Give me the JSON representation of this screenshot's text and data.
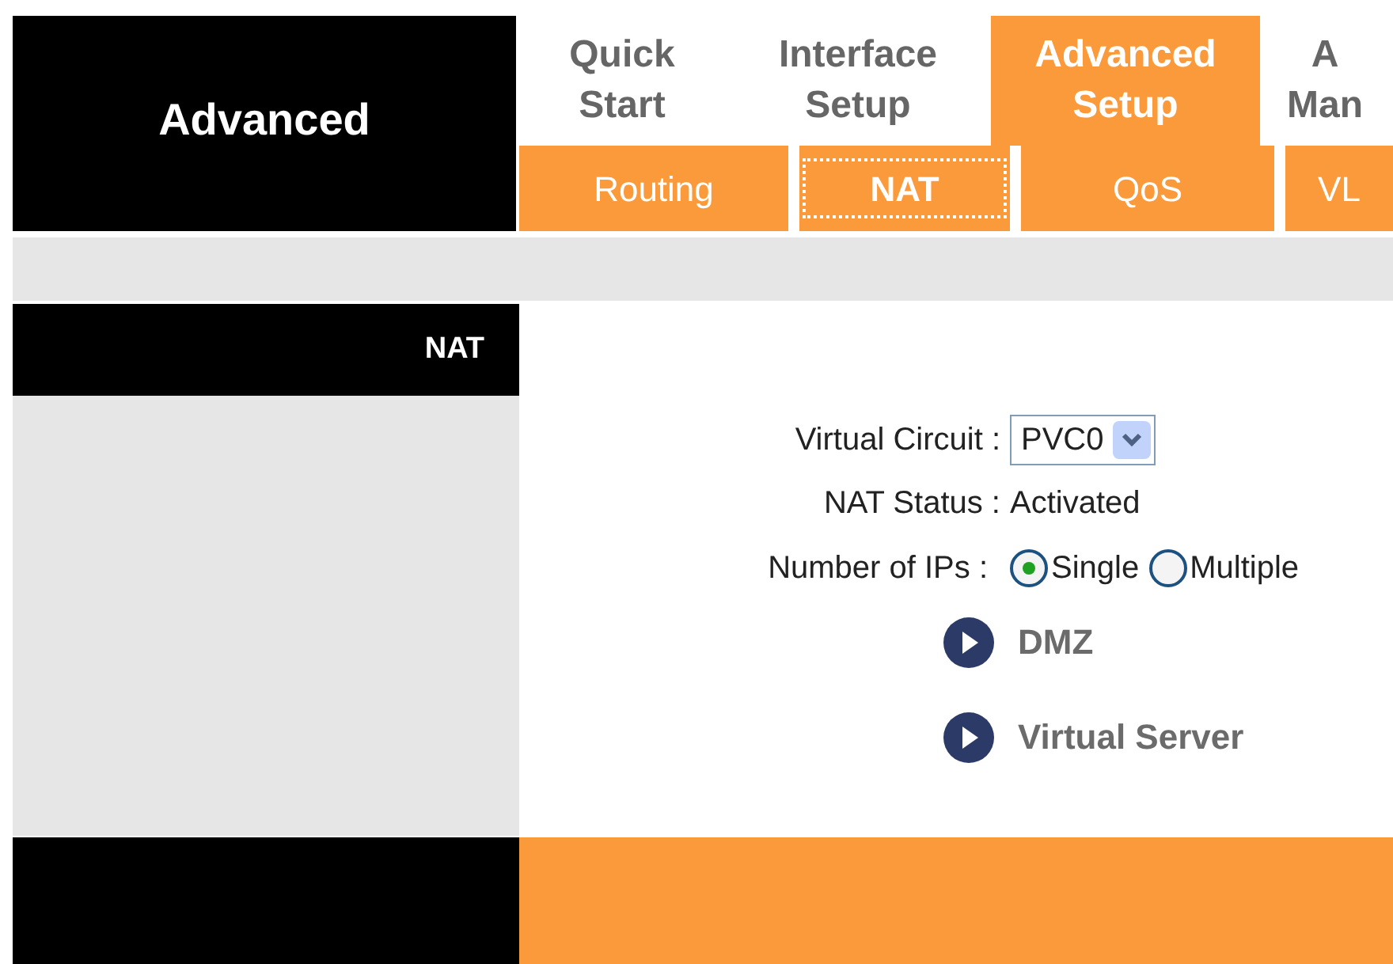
{
  "section_title": "Advanced",
  "tabs": [
    {
      "lines": [
        "Quick",
        "Start"
      ],
      "selected": false
    },
    {
      "lines": [
        "Interface",
        "Setup"
      ],
      "selected": false
    },
    {
      "lines": [
        "Advanced",
        "Setup"
      ],
      "selected": true
    },
    {
      "lines": [
        "A",
        "Man"
      ],
      "selected": false
    }
  ],
  "subtabs": [
    {
      "label": "Routing",
      "selected": false
    },
    {
      "label": "NAT",
      "selected": true
    },
    {
      "label": "QoS",
      "selected": false
    },
    {
      "label": "VL",
      "selected": false
    }
  ],
  "panel_title": "NAT",
  "form": {
    "virtual_circuit": {
      "label": "Virtual Circuit :",
      "value": "PVC0"
    },
    "nat_status": {
      "label": "NAT Status :",
      "value": "Activated"
    },
    "number_of_ips": {
      "label": "Number of IPs :",
      "options": [
        {
          "label": "Single",
          "selected": true
        },
        {
          "label": "Multiple",
          "selected": false
        }
      ]
    }
  },
  "links": [
    "DMZ",
    "Virtual Server"
  ]
}
